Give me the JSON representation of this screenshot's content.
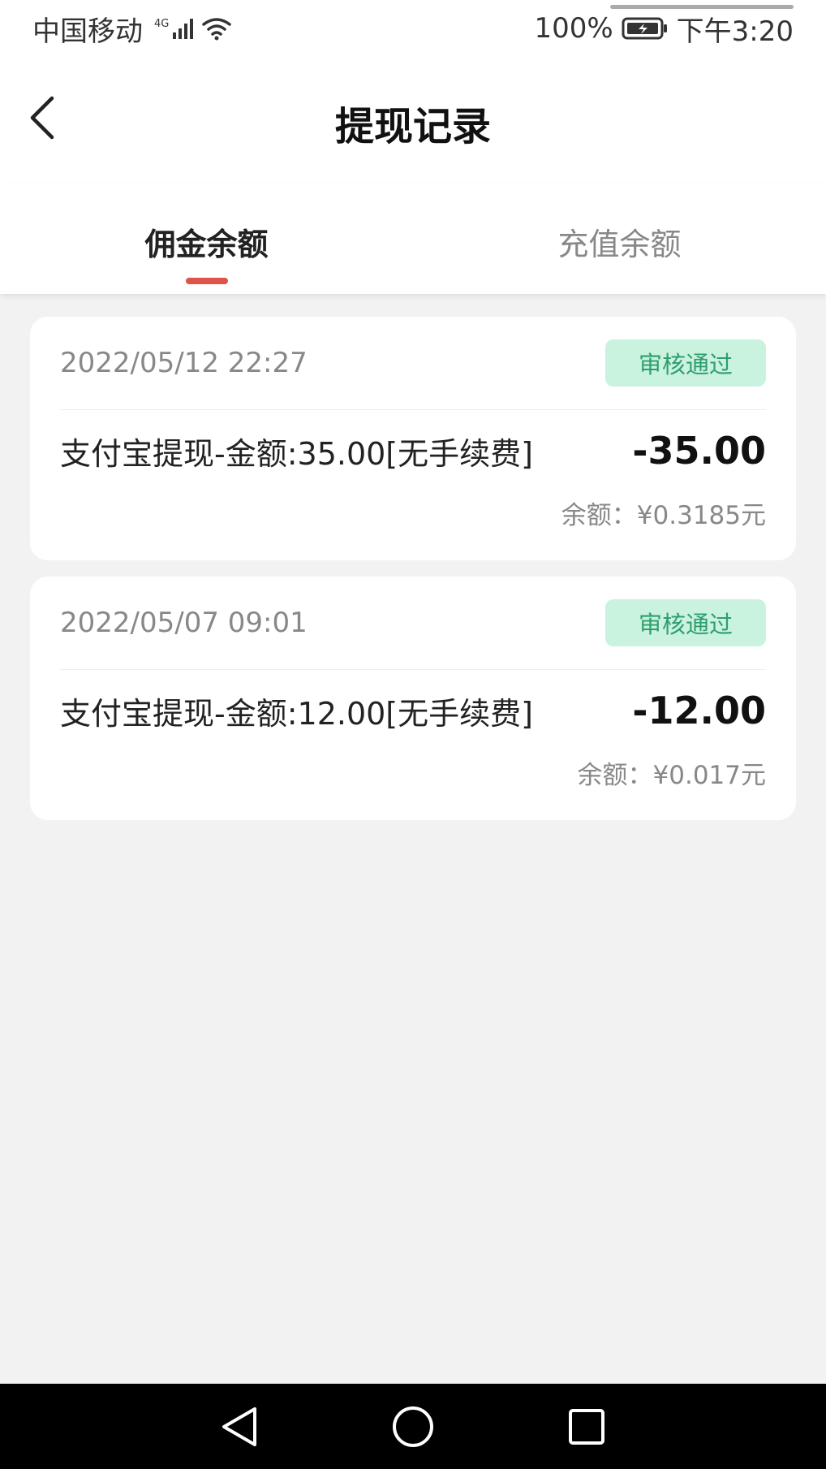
{
  "status_bar": {
    "carrier": "中国移动",
    "network": "4G",
    "battery": "100%",
    "time": "下午3:20"
  },
  "header": {
    "title": "提现记录"
  },
  "tabs": [
    {
      "label": "佣金余额",
      "active": true
    },
    {
      "label": "充值余额",
      "active": false
    }
  ],
  "records": [
    {
      "datetime": "2022/05/12 22:27",
      "status": "审核通过",
      "description": "支付宝提现-金额:35.00[无手续费]",
      "amount": "-35.00",
      "balance": "余额：¥0.3185元"
    },
    {
      "datetime": "2022/05/07 09:01",
      "status": "审核通过",
      "description": "支付宝提现-金额:12.00[无手续费]",
      "amount": "-12.00",
      "balance": "余额：¥0.017元"
    }
  ],
  "colors": {
    "accent": "#e0524a",
    "badge_bg": "#c9f2df",
    "badge_text": "#2f9e6c"
  },
  "icons": {
    "back": "chevron-left-icon",
    "nav_back": "triangle-back-icon",
    "nav_home": "circle-home-icon",
    "nav_recent": "square-recent-icon"
  }
}
